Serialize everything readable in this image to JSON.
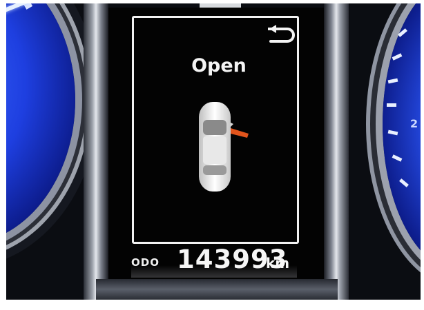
{
  "display": {
    "status": "Open",
    "back_icon": "return-arrow-icon",
    "door_indicator_color": "#e2541c",
    "odometer": {
      "label": "ODO",
      "value": "143993",
      "unit": "km"
    }
  },
  "gauges": {
    "right_number": "2"
  },
  "colors": {
    "gauge_blue": "#2347dd",
    "display_text": "#f4f4f4"
  }
}
